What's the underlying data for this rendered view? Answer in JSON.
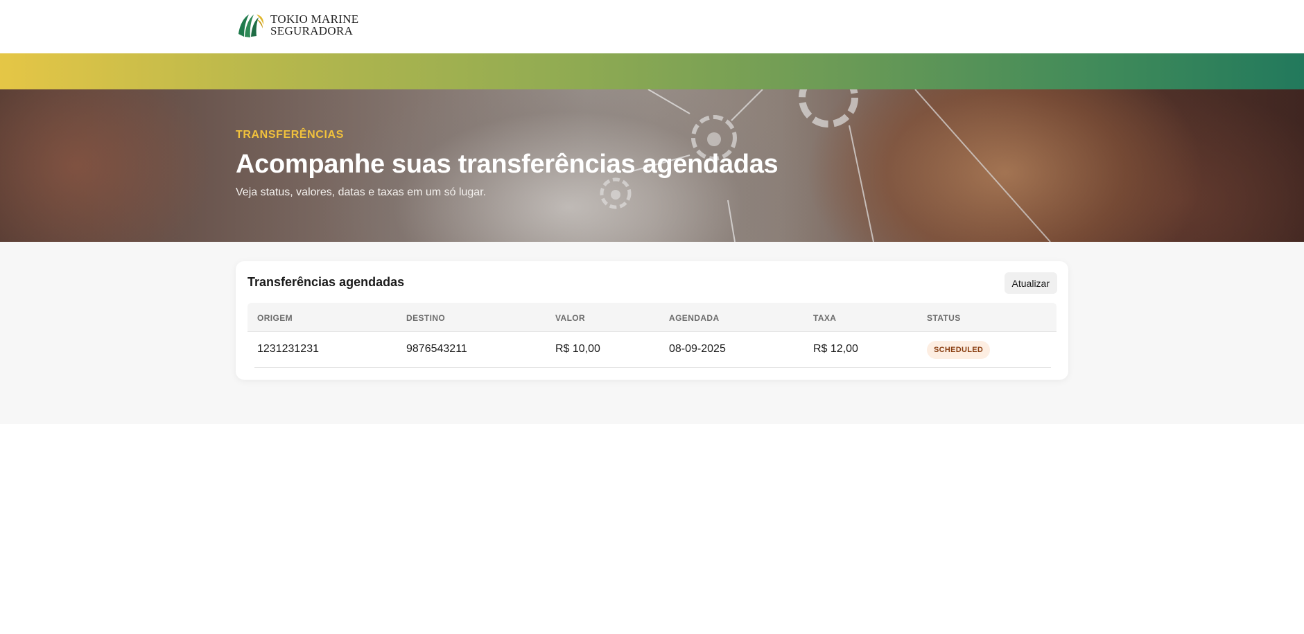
{
  "brand": {
    "logo_line1": "TOKIO MARINE",
    "logo_line2": "SEGURADORA",
    "colors": {
      "gradient_start": "#e5c646",
      "gradient_end": "#22795c",
      "accent_yellow": "#f2c23c",
      "logo_green": "#1f7a4c"
    }
  },
  "hero": {
    "kicker": "TRANSFERÊNCIAS",
    "title": "Acompanhe suas transferências agendadas",
    "subtitle": "Veja status, valores, datas e taxas em um só lugar."
  },
  "card": {
    "title": "Transferências agendadas",
    "refresh_label": "Atualizar",
    "columns": [
      "ORIGEM",
      "DESTINO",
      "VALOR",
      "AGENDADA",
      "TAXA",
      "STATUS"
    ],
    "rows": [
      {
        "origem": "1231231231",
        "destino": "9876543211",
        "valor": "R$ 10,00",
        "agendada": "08-09-2025",
        "taxa": "R$ 12,00",
        "status": "SCHEDULED"
      }
    ]
  }
}
